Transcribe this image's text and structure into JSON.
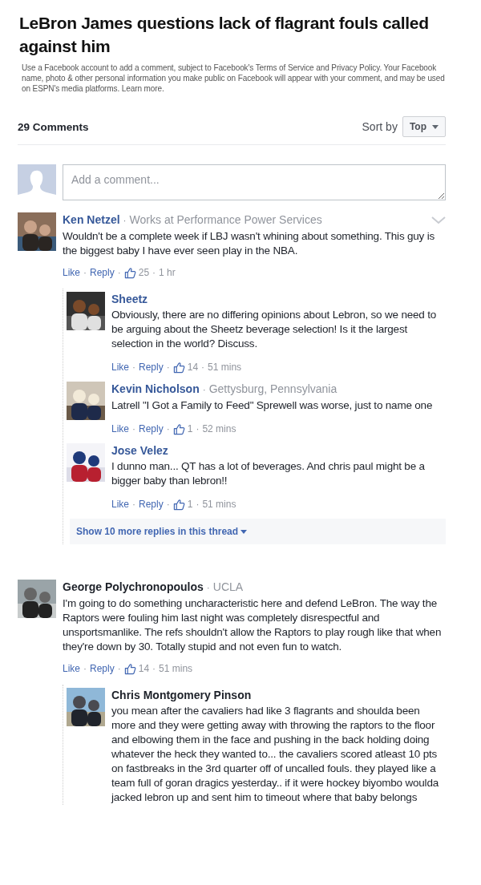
{
  "article": {
    "title": "LeBron James questions lack of flagrant fouls called against him"
  },
  "disclaimer": "Use a Facebook account to add a comment, subject to Facebook's Terms of Service and Privacy Policy. Your Facebook name, photo & other personal information you make public on Facebook will appear with your comment, and may be used on ESPN's media platforms. Learn more.",
  "separator": "·",
  "comments_header": {
    "count": "29 Comments",
    "sort_label": "Sort by",
    "sort_value": "Top"
  },
  "composer": {
    "placeholder": "Add a comment..."
  },
  "comments": [
    {
      "author": "Ken Netzel",
      "linked": true,
      "meta": "Works at Performance Power Services",
      "menu_chevron": true,
      "avatar": {
        "kind": "picture"
      },
      "text": "Wouldn't be a complete week if LBJ wasn't whining about something. This guy is the biggest baby I have ever seen play in the NBA.",
      "actions": {
        "like": "Like",
        "reply": "Reply",
        "likes": "25",
        "time": "1 hr"
      },
      "replies": [
        {
          "author": "Sheetz",
          "linked": true,
          "avatar": {
            "kind": "picture"
          },
          "text": "Obviously, there are no differing opinions about Lebron, so we need to be arguing about the Sheetz beverage selection! Is it the largest selection in the world? Discuss.",
          "actions": {
            "like": "Like",
            "reply": "Reply",
            "likes": "14",
            "time": "51 mins"
          }
        },
        {
          "author": "Kevin Nicholson",
          "linked": true,
          "meta": "Gettysburg, Pennsylvania",
          "avatar": {
            "kind": "picture"
          },
          "text": "Latrell \"I Got a Family to Feed\" Sprewell was worse, just to name one",
          "actions": {
            "like": "Like",
            "reply": "Reply",
            "likes": "1",
            "time": "52 mins"
          }
        },
        {
          "author": "Jose Velez",
          "linked": true,
          "avatar": {
            "kind": "picture"
          },
          "text": "I dunno man... QT has a lot of beverages. And chris paul might be a bigger baby than lebron!!",
          "actions": {
            "like": "Like",
            "reply": "Reply",
            "likes": "1",
            "time": "51 mins"
          }
        }
      ],
      "more_replies": "Show 10 more replies in this thread"
    },
    {
      "author": "George Polychronopoulos",
      "linked": false,
      "meta": "UCLA",
      "avatar": {
        "kind": "picture"
      },
      "text": "I'm going to do something uncharacteristic here and defend LeBron. The way the Raptors were fouling him last night was completely disrespectful and unsportsmanlike. The refs shouldn't allow the Raptors to play rough like that when they're down by 30. Totally stupid and not even fun to watch.",
      "actions": {
        "like": "Like",
        "reply": "Reply",
        "likes": "14",
        "time": "51 mins"
      },
      "replies": [
        {
          "author": "Chris Montgomery Pinson",
          "linked": false,
          "avatar": {
            "kind": "picture"
          },
          "text": "you mean after the cavaliers had like 3 flagrants and shoulda been more and they were getting away with throwing the raptors to the floor and elbowing them in the face and pushing in the back holding doing whatever the heck they wanted to... the cavaliers scored atleast 10 pts on fastbreaks in the 3rd quarter off of uncalled fouls. they played like a team full of goran dragics yesterday.. if it were hockey biyombo woulda jacked lebron up and sent him to timeout where that baby belongs"
        }
      ]
    }
  ]
}
